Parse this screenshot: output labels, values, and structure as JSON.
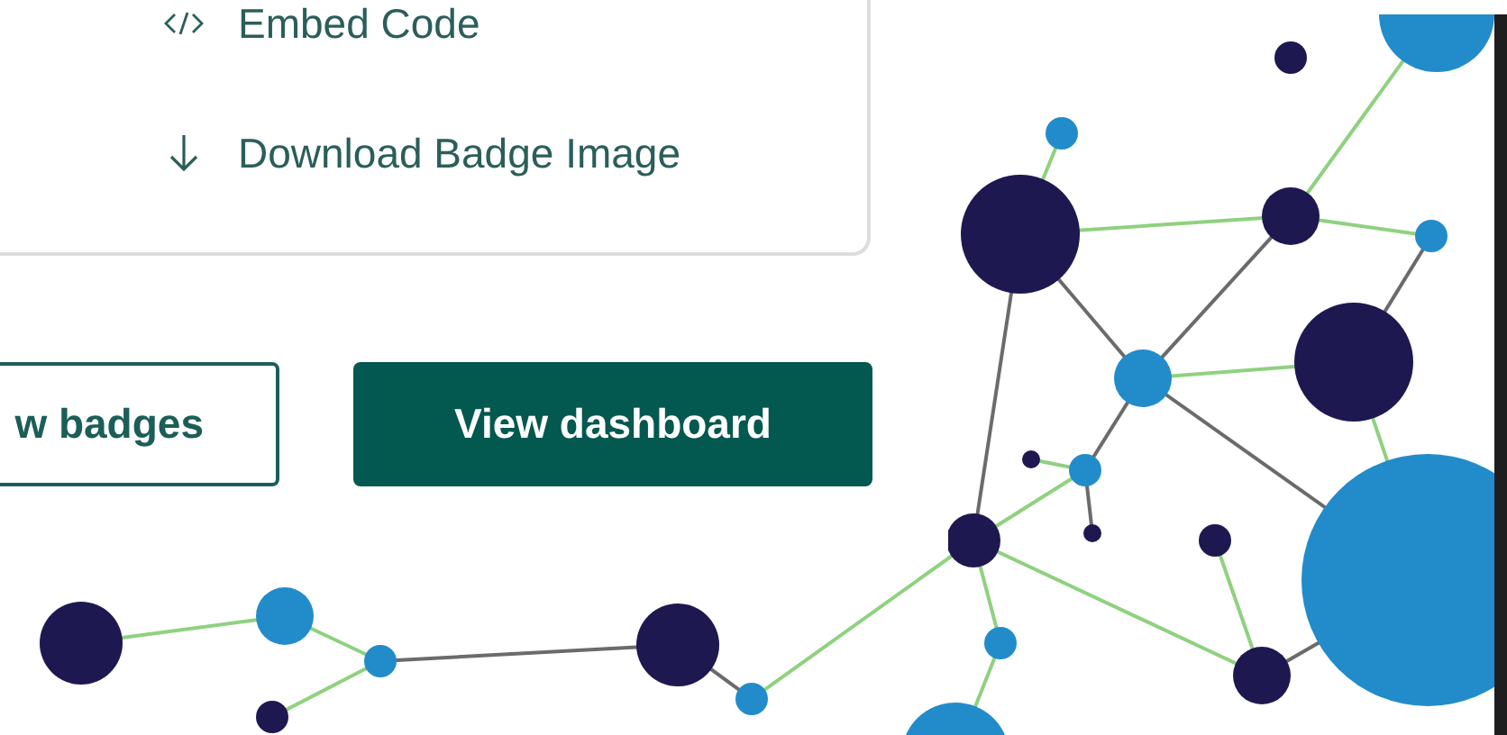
{
  "share_menu": {
    "items": [
      {
        "kind": "code",
        "label": "Embed Code"
      },
      {
        "kind": "download",
        "label": "Download Badge Image"
      }
    ]
  },
  "buttons": [
    {
      "kind": "outline",
      "label": "w badges"
    },
    {
      "kind": "primary",
      "label": "View dashboard"
    }
  ]
}
